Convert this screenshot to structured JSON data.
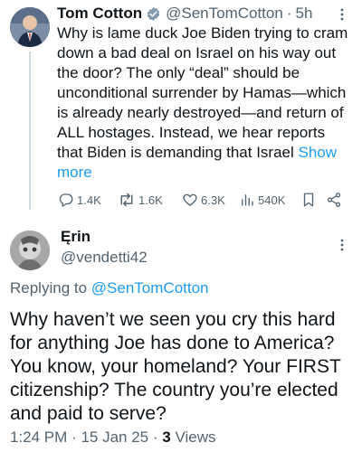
{
  "tweet": {
    "author_name": "Tom Cotton",
    "handle": "@SenTomCotton",
    "separator": "·",
    "time": "5h",
    "text": "Why is lame duck Joe Biden trying to cram down a bad deal on Israel on his way out the door? The only “deal” should be unconditional surrender by Hamas—which is already nearly destroyed—and return of ALL hostages. Instead, we hear reports that Biden is demanding that Israel",
    "show_more": "Show more",
    "stats": {
      "replies": "1.4K",
      "reposts": "1.6K",
      "likes": "6.3K",
      "views": "540K"
    }
  },
  "reply": {
    "author_name": "Ęrin",
    "handle": "@vendetti42",
    "replying_label": "Replying to",
    "replying_handle": "@SenTomCotton",
    "text": "Why haven’t we seen you cry this hard for anything Joe has done to America? You know, your homeland? Your FIRST citizenship? The country you’re elected and paid to serve?",
    "time": "1:24 PM",
    "dot": "·",
    "date": "15 Jan 25",
    "views_count": "3",
    "views_label": "Views"
  },
  "colors": {
    "text": "#0f1419",
    "secondary": "#536471",
    "accent": "#1d9bf0",
    "divider": "#cfd9de"
  }
}
